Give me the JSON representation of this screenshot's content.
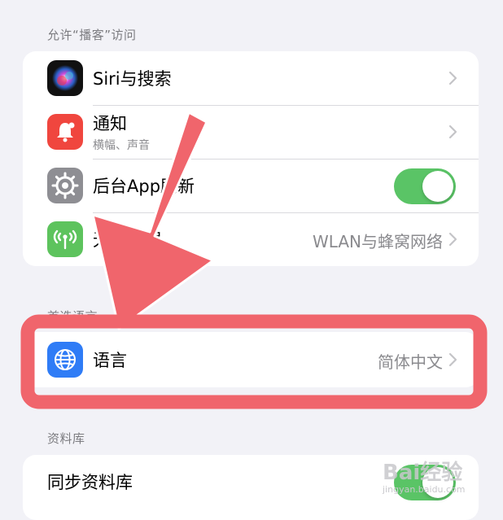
{
  "sections": {
    "allow_access_header": "允许“播客”访问",
    "preferred_language_header": "首选语言",
    "library_header": "资料库"
  },
  "rows": {
    "siri": {
      "label": "Siri与搜索"
    },
    "notifications": {
      "label": "通知",
      "sublabel": "横幅、声音"
    },
    "background_refresh": {
      "label": "后台App刷新",
      "toggle_on": true
    },
    "wireless": {
      "label": "无线数据",
      "value": "WLAN与蜂窝网络"
    },
    "language": {
      "label": "语言",
      "value": "简体中文"
    },
    "sync_library": {
      "label": "同步资料库",
      "toggle_on": true
    }
  },
  "watermark": {
    "brand": "Bai经验",
    "url": "jingyan.baidu.com"
  },
  "colors": {
    "background": "#f2f2f7",
    "toggle_on": "#5ac466",
    "annotation": "#f0656c",
    "notification_icon": "#f0463e",
    "wireless_icon": "#5dc35d",
    "language_icon": "#2f7cf6",
    "settings_icon": "#8e8e93"
  },
  "icons": {
    "siri": "siri-orb-icon",
    "notifications": "bell-icon",
    "background_refresh": "gear-icon",
    "wireless": "antenna-icon",
    "language": "globe-icon",
    "chevron": "chevron-right-icon"
  }
}
